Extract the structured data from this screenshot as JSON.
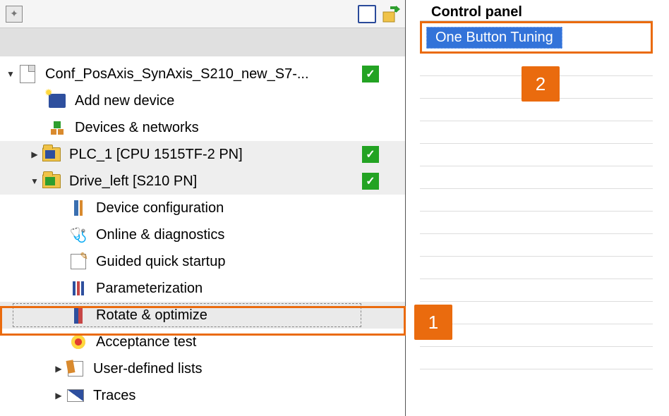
{
  "toolbar": {
    "app_icon_name": "app-icon",
    "box_icon_name": "properties-icon",
    "arrow_icon_name": "export-icon"
  },
  "tree": {
    "root": {
      "label": "Conf_PosAxis_SynAxis_S210_new_S7-...",
      "checked": true
    },
    "add_device": {
      "label": "Add new device"
    },
    "devices_networks": {
      "label": "Devices & networks"
    },
    "plc": {
      "label": "PLC_1 [CPU 1515TF-2 PN]",
      "checked": true
    },
    "drive": {
      "label": "Drive_left [S210 PN]",
      "checked": true
    },
    "device_config": {
      "label": "Device configuration"
    },
    "diagnostics": {
      "label": "Online & diagnostics"
    },
    "guided": {
      "label": "Guided quick startup"
    },
    "parameterization": {
      "label": "Parameterization"
    },
    "rotate": {
      "label": "Rotate & optimize"
    },
    "acceptance": {
      "label": "Acceptance test"
    },
    "user_lists": {
      "label": "User-defined lists"
    },
    "traces": {
      "label": "Traces"
    }
  },
  "right": {
    "header": "Control panel",
    "button_label": "One Button Tuning"
  },
  "annotations": {
    "badge1": "1",
    "badge2": "2"
  }
}
